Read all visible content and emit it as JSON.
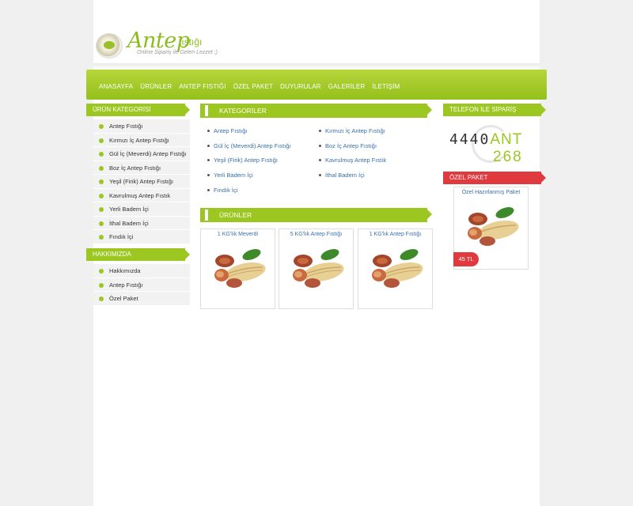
{
  "brand": {
    "title": "Antep",
    "suffix": "fıstığı",
    "slogan": "Online Sipariş ile  Gelen Lezzet ;)"
  },
  "nav": {
    "items": [
      "ANASAYFA",
      "ÜRÜNLER",
      "ANTEP FISTIĞI",
      "ÖZEL PAKET",
      "DUYURULAR",
      "GALERİLER",
      "İLETİŞİM"
    ]
  },
  "left": {
    "category_title": "ÜRÜN KATEGORİSİ",
    "categories": [
      "Antep Fıstığı",
      "Kırmızı İç Antep Fıstığı",
      "Gül İç (Meverdi) Antep Fıstığı",
      "Boz İç Antep Fıstığı",
      "Yeşil (Firik) Antep Fıstığı",
      "Kavrulmuş Antep Fıstık",
      "Yerli Badem İçi",
      "İthal Badem İçi",
      "Fındık İçi"
    ],
    "about_title": "HAKKIMIZDA",
    "about": [
      "Hakkımızda",
      "Antep Fıstığı",
      "Özel Paket"
    ]
  },
  "main": {
    "categories_title": "KATEGORİLER",
    "col1": [
      "Antep Fıstığı",
      "Gül İç (Meverdi) Antep Fıstığı",
      "Yeşil (Firik) Antep Fıstığı",
      "Yerli Badem İçi",
      "Fındık İçi"
    ],
    "col2": [
      "Kırmızı İç Antep Fıstığı",
      "Boz İç Antep Fıstığı",
      "Kavrulmuş Antep Fıstık",
      "İthal Badem İçi"
    ],
    "products_title": "ÜRÜNLER",
    "products": [
      {
        "name": "1 KG'lık Meverdi"
      },
      {
        "name": "5 KG'lık Antep Fıstığı"
      },
      {
        "name": "1 KG'lık Antep Fıstığı"
      }
    ]
  },
  "right": {
    "phone_title": "TELEFON İLE SİPARİŞ",
    "phone_part1": "4440",
    "phone_part2": "ANT",
    "phone_part3": "268",
    "special_title": "ÖZEL PAKET",
    "special_name": "Özel Hazırlanmış Paket",
    "special_price": "45 TL"
  },
  "colors": {
    "accent": "#9cc620",
    "red": "#e03a3e",
    "link": "#3a6faa"
  }
}
